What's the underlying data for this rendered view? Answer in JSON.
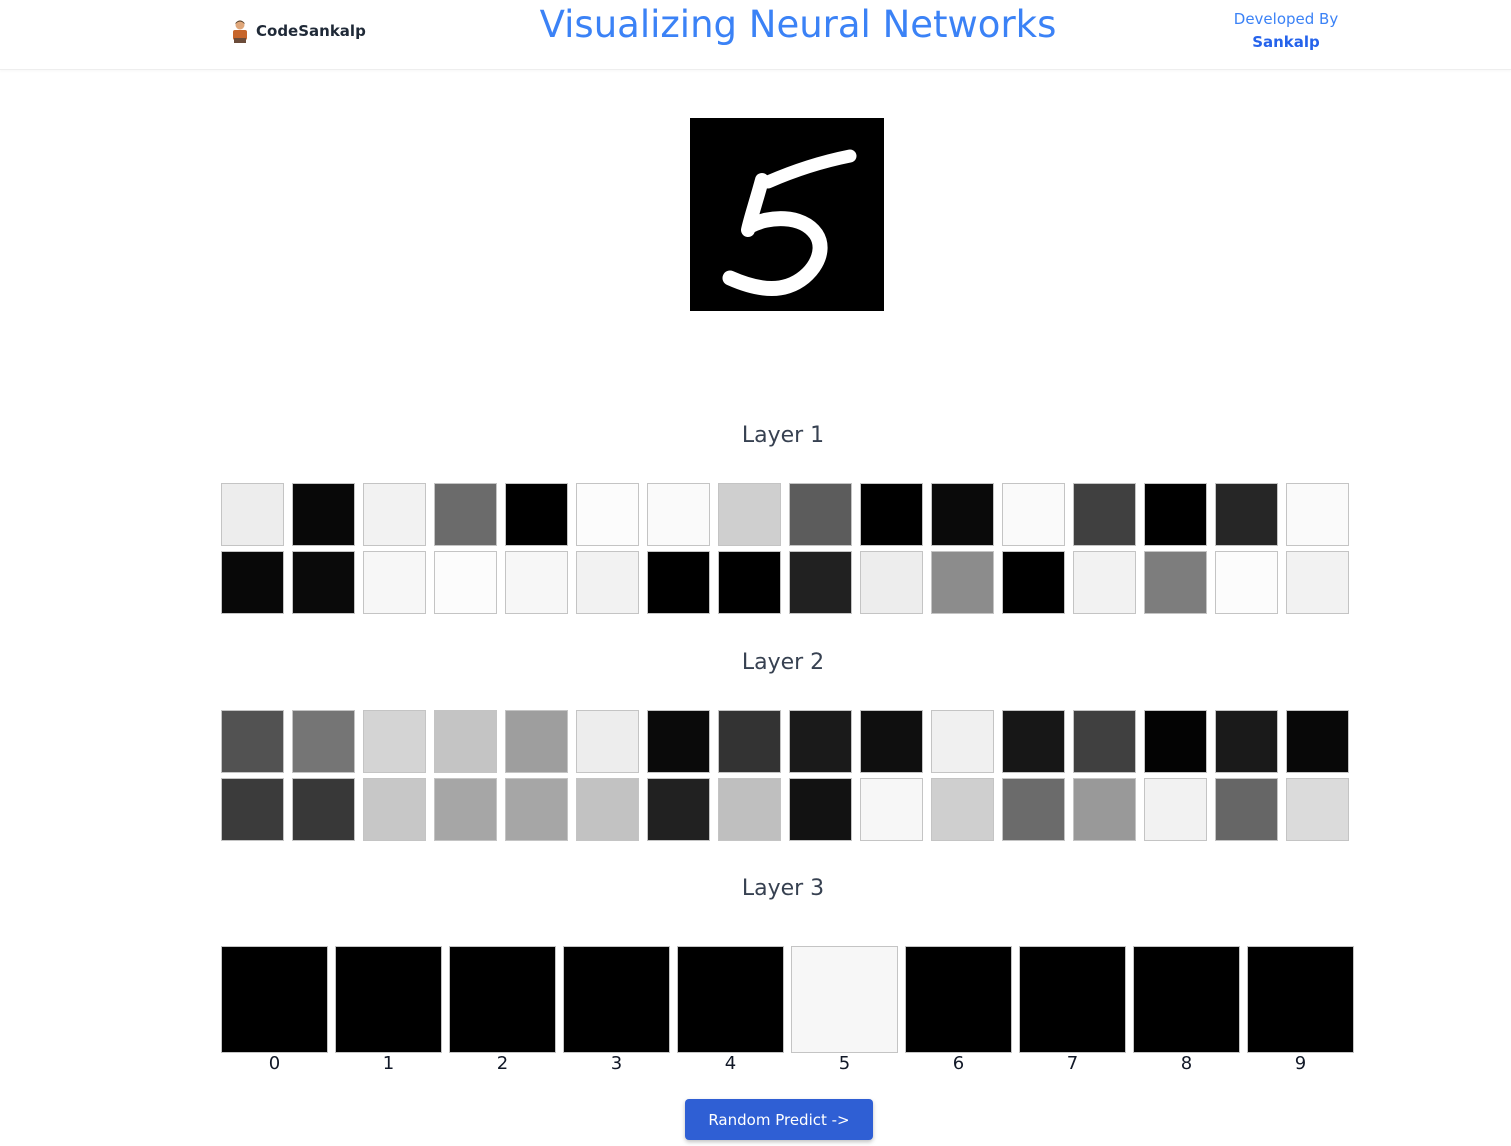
{
  "header": {
    "brand": {
      "name": "CodeSankalp",
      "logo_icon": "developer-avatar-icon"
    },
    "title": "Visualizing Neural Networks",
    "developer": {
      "label": "Developed By",
      "name": "Sankalp"
    }
  },
  "input_image": {
    "icon": "handwritten-digit-image",
    "digit": "5"
  },
  "layers": [
    {
      "title": "Layer 1",
      "activations": [
        0.93,
        0.03,
        0.95,
        0.42,
        0.0,
        0.99,
        0.98,
        0.81,
        0.36,
        0.0,
        0.04,
        0.98,
        0.25,
        0.0,
        0.15,
        0.98,
        0.03,
        0.04,
        0.97,
        0.99,
        0.97,
        0.95,
        0.0,
        0.0,
        0.13,
        0.93,
        0.55,
        0.0,
        0.95,
        0.49,
        0.99,
        0.95
      ]
    },
    {
      "title": "Layer 2",
      "activations": [
        0.32,
        0.46,
        0.83,
        0.77,
        0.62,
        0.93,
        0.04,
        0.2,
        0.1,
        0.06,
        0.94,
        0.09,
        0.25,
        0.01,
        0.1,
        0.03,
        0.23,
        0.22,
        0.78,
        0.65,
        0.65,
        0.76,
        0.13,
        0.75,
        0.07,
        0.97,
        0.81,
        0.42,
        0.6,
        0.95,
        0.4,
        0.86
      ]
    }
  ],
  "output_layer": {
    "title": "Layer 3",
    "labels": [
      "0",
      "1",
      "2",
      "3",
      "4",
      "5",
      "6",
      "7",
      "8",
      "9"
    ],
    "activations": [
      0.0,
      0.0,
      0.0,
      0.0,
      0.0,
      0.97,
      0.0,
      0.0,
      0.0,
      0.0
    ]
  },
  "predict_button": {
    "label": "Random Predict ->"
  },
  "colors": {
    "accent": "#3b82f6",
    "button": "#2f5fd4"
  }
}
